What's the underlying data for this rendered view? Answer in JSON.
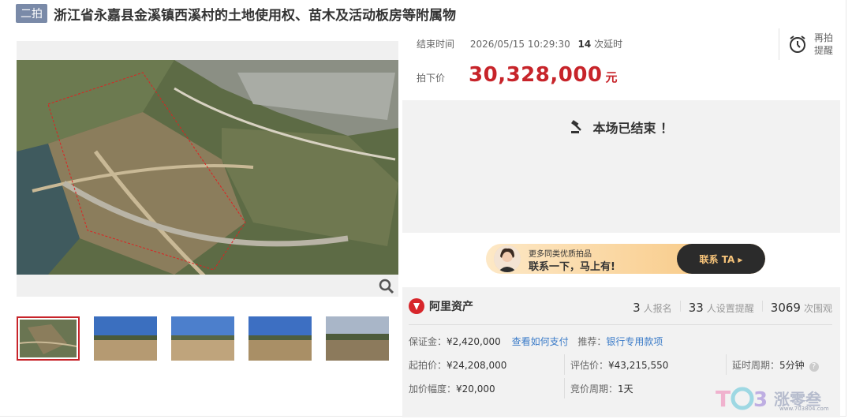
{
  "title": {
    "badge": "二拍",
    "text": "浙江省永嘉县金溪镇西溪村的土地使用权、苗木及活动板房等附属物"
  },
  "gallery": {
    "main_image": "aerial-land-photo",
    "zoom_icon": "magnifier-icon",
    "thumbnails": [
      "aerial-land-photo",
      "cleared-site-photo-1",
      "cleared-site-photo-2",
      "cleared-site-photo-3",
      "cleared-site-photo-4"
    ]
  },
  "auction": {
    "end_label": "结束时间",
    "end_time": "2026/05/15 10:29:30",
    "delay_count": "14",
    "delay_suffix": "次延时",
    "price_label": "拍下价",
    "price": "30,328,000",
    "price_unit": "元",
    "remind_line1": "再拍",
    "remind_line2": "提醒",
    "ended_text": "本场已结束 ！"
  },
  "banner": {
    "line1": "更多同类优质拍品",
    "line2": "联系一下，马上有!",
    "cta": "联系 TA ▸"
  },
  "detail": {
    "brand_name": "阿里资产",
    "stats": {
      "signups": "3",
      "signups_label": "人报名",
      "reminders": "33",
      "reminders_label": "人设置提醒",
      "views": "3069",
      "views_label": "次围观"
    },
    "deposit_label": "保证金：",
    "deposit_value": "¥2,420,000",
    "how_to_pay": "查看如何支付",
    "recommend_label": "推荐：",
    "recommend_link": "银行专用款项",
    "start_price_label": "起拍价：",
    "start_price_value": "¥24,208,000",
    "appraisal_label": "评估价：",
    "appraisal_value": "¥43,215,550",
    "delay_period_label": "延时周期：",
    "delay_period_value": "5分钟",
    "increment_label": "加价幅度：",
    "increment_value": "¥20,000",
    "bid_period_label": "竞价周期：",
    "bid_period_value": "1天"
  },
  "watermark": {
    "text": "涨零叁",
    "url": "www.703804.com"
  },
  "colors": {
    "price_red": "#c7242a",
    "link_blue": "#3a7bc8",
    "badge": "#7a8aa8"
  }
}
